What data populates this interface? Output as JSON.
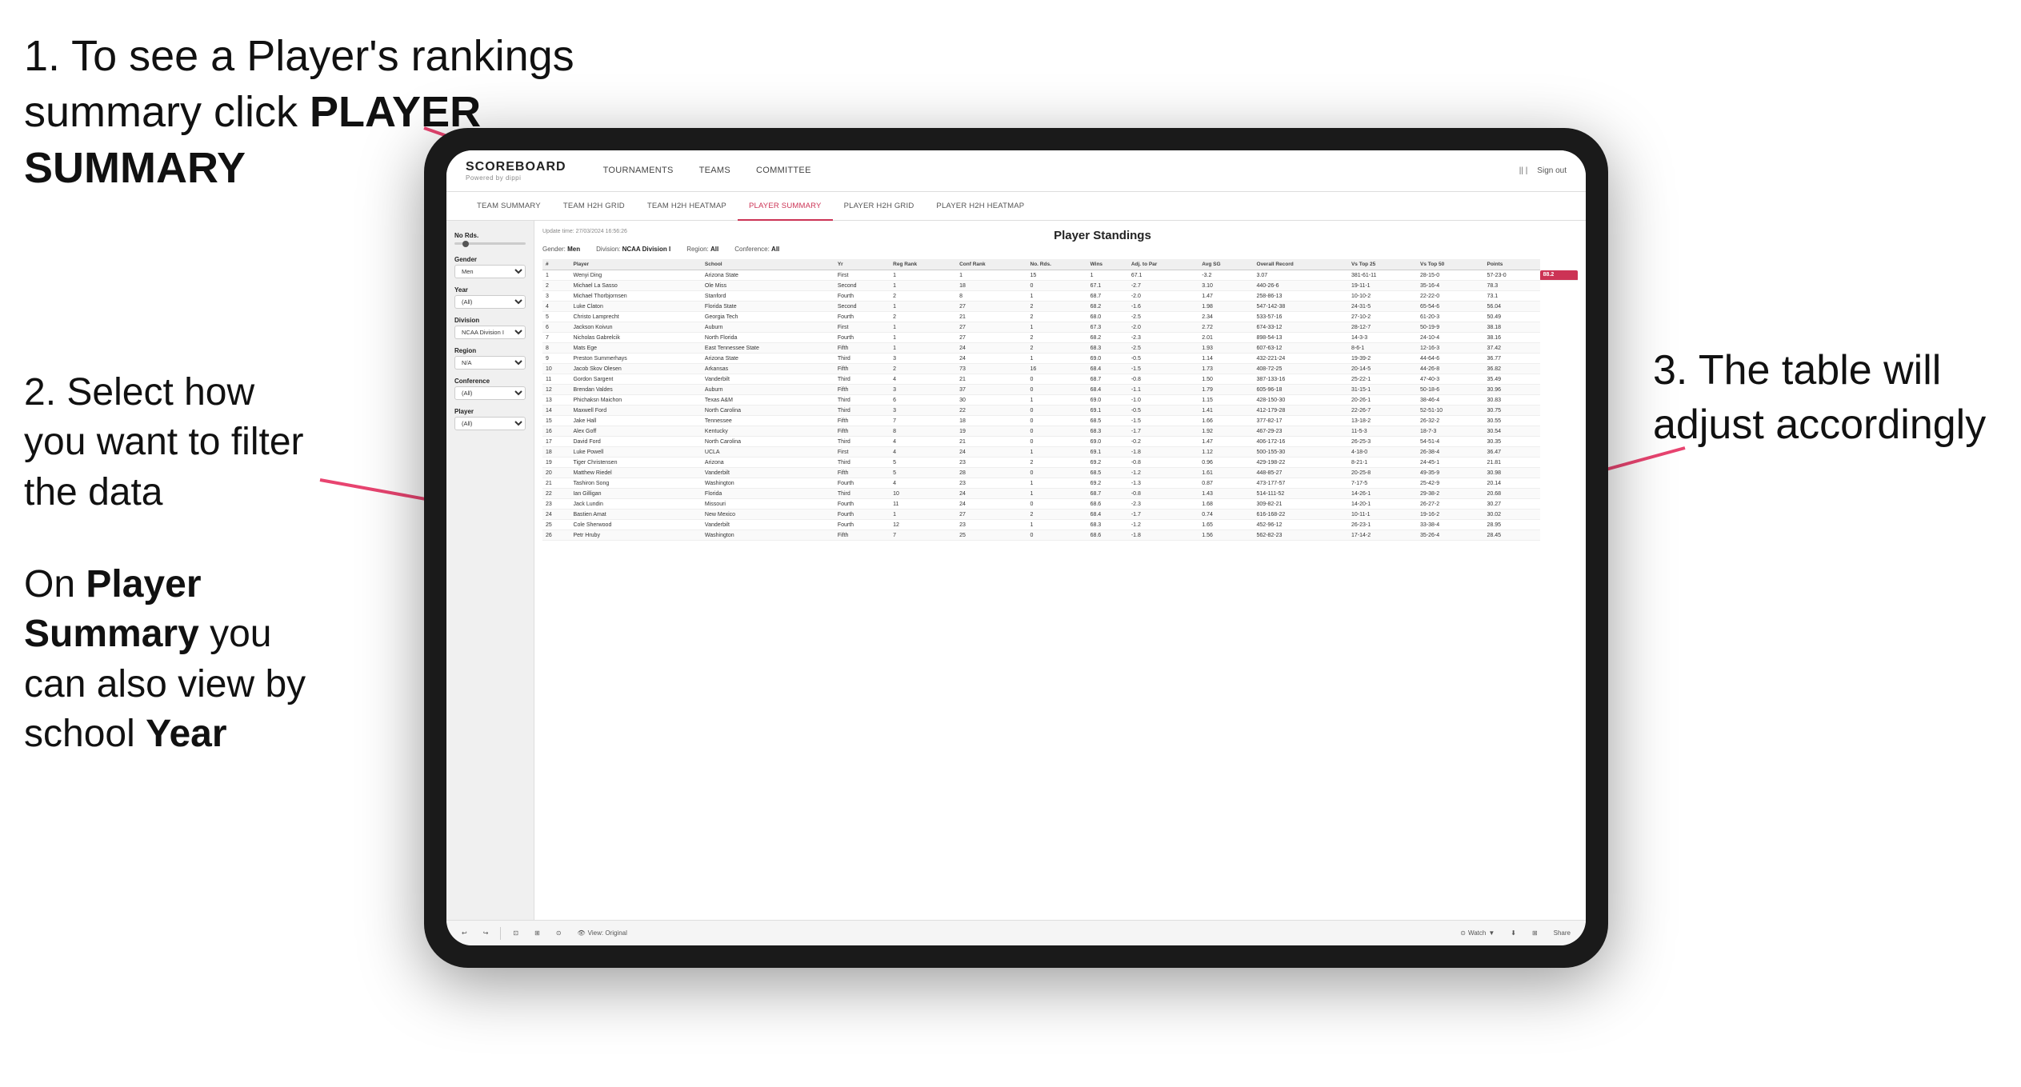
{
  "instructions": {
    "step1": "1. To see a Player's rankings summary click ",
    "step1_bold": "PLAYER SUMMARY",
    "step2_title": "2. Select how you want to filter the data",
    "step3": "3. The table will adjust accordingly",
    "step4_pre": "On ",
    "step4_bold1": "Player Summary",
    "step4_mid": " you can also view by school ",
    "step4_bold2": "Year"
  },
  "app": {
    "logo_main": "SCOREBOARD",
    "logo_sub": "Powered by dippi",
    "nav": [
      {
        "label": "TOURNAMENTS",
        "active": false
      },
      {
        "label": "TEAMS",
        "active": false
      },
      {
        "label": "COMMITTEE",
        "active": false
      }
    ],
    "header_right_icon": "||",
    "sign_out": "Sign out",
    "sub_nav": [
      {
        "label": "TEAM SUMMARY",
        "active": false
      },
      {
        "label": "TEAM H2H GRID",
        "active": false
      },
      {
        "label": "TEAM H2H HEATMAP",
        "active": false
      },
      {
        "label": "PLAYER SUMMARY",
        "active": true
      },
      {
        "label": "PLAYER H2H GRID",
        "active": false
      },
      {
        "label": "PLAYER H2H HEATMAP",
        "active": false
      }
    ]
  },
  "filters": {
    "no_rds_label": "No Rds.",
    "gender_label": "Gender",
    "gender_value": "Men",
    "year_label": "Year",
    "year_value": "(All)",
    "division_label": "Division",
    "division_value": "NCAA Division I",
    "region_label": "Region",
    "region_value": "N/A",
    "conference_label": "Conference",
    "conference_value": "(All)",
    "player_label": "Player",
    "player_value": "(All)"
  },
  "table": {
    "title": "Player Standings",
    "update_time": "Update time:",
    "update_date": "27/03/2024 16:56:26",
    "meta": [
      {
        "label": "Gender: ",
        "value": "Men"
      },
      {
        "label": "Division: ",
        "value": "NCAA Division I"
      },
      {
        "label": "Region: ",
        "value": "All"
      },
      {
        "label": "Conference: ",
        "value": "All"
      }
    ],
    "columns": [
      "#",
      "Player",
      "School",
      "Yr",
      "Reg Rank",
      "Conf Rank",
      "No. Rds.",
      "Wins",
      "Adj. to Par",
      "Avg SG",
      "Overall Record",
      "Vs Top 25",
      "Vs Top 50",
      "Points"
    ],
    "rows": [
      [
        "1",
        "Wenyi Ding",
        "Arizona State",
        "First",
        "1",
        "1",
        "15",
        "1",
        "67.1",
        "-3.2",
        "3.07",
        "381-61-11",
        "28-15-0",
        "57-23-0",
        "88.2"
      ],
      [
        "2",
        "Michael La Sasso",
        "Ole Miss",
        "Second",
        "1",
        "18",
        "0",
        "67.1",
        "-2.7",
        "3.10",
        "440-26-6",
        "19-11-1",
        "35-16-4",
        "78.3"
      ],
      [
        "3",
        "Michael Thorbjornsen",
        "Stanford",
        "Fourth",
        "2",
        "8",
        "1",
        "68.7",
        "-2.0",
        "1.47",
        "258-86-13",
        "10-10-2",
        "22-22-0",
        "73.1"
      ],
      [
        "4",
        "Luke Claton",
        "Florida State",
        "Second",
        "1",
        "27",
        "2",
        "68.2",
        "-1.6",
        "1.98",
        "547-142-38",
        "24-31-5",
        "65-54-6",
        "56.04"
      ],
      [
        "5",
        "Christo Lamprecht",
        "Georgia Tech",
        "Fourth",
        "2",
        "21",
        "2",
        "68.0",
        "-2.5",
        "2.34",
        "533-57-16",
        "27-10-2",
        "61-20-3",
        "50.49"
      ],
      [
        "6",
        "Jackson Koivun",
        "Auburn",
        "First",
        "1",
        "27",
        "1",
        "67.3",
        "-2.0",
        "2.72",
        "674-33-12",
        "28-12-7",
        "50-19-9",
        "38.18"
      ],
      [
        "7",
        "Nicholas Gabrelcik",
        "North Florida",
        "Fourth",
        "1",
        "27",
        "2",
        "68.2",
        "-2.3",
        "2.01",
        "898-54-13",
        "14-3-3",
        "24-10-4",
        "38.16"
      ],
      [
        "8",
        "Mats Ege",
        "East Tennessee State",
        "Fifth",
        "1",
        "24",
        "2",
        "68.3",
        "-2.5",
        "1.93",
        "607-63-12",
        "8-6-1",
        "12-16-3",
        "37.42"
      ],
      [
        "9",
        "Preston Summerhays",
        "Arizona State",
        "Third",
        "3",
        "24",
        "1",
        "69.0",
        "-0.5",
        "1.14",
        "432-221-24",
        "19-39-2",
        "44-64-6",
        "36.77"
      ],
      [
        "10",
        "Jacob Skov Olesen",
        "Arkansas",
        "Fifth",
        "2",
        "73",
        "16",
        "68.4",
        "-1.5",
        "1.73",
        "408-72-25",
        "20-14-5",
        "44-26-8",
        "36.82"
      ],
      [
        "11",
        "Gordon Sargent",
        "Vanderbilt",
        "Third",
        "4",
        "21",
        "0",
        "68.7",
        "-0.8",
        "1.50",
        "387-133-16",
        "25-22-1",
        "47-40-3",
        "35.49"
      ],
      [
        "12",
        "Brendan Valdes",
        "Auburn",
        "Fifth",
        "3",
        "37",
        "0",
        "68.4",
        "-1.1",
        "1.79",
        "605-96-18",
        "31-15-1",
        "50-18-6",
        "30.96"
      ],
      [
        "13",
        "Phichaksn Maichon",
        "Texas A&M",
        "Third",
        "6",
        "30",
        "1",
        "69.0",
        "-1.0",
        "1.15",
        "428-150-30",
        "20-26-1",
        "38-46-4",
        "30.83"
      ],
      [
        "14",
        "Maxwell Ford",
        "North Carolina",
        "Third",
        "3",
        "22",
        "0",
        "69.1",
        "-0.5",
        "1.41",
        "412-179-28",
        "22-26-7",
        "52-51-10",
        "30.75"
      ],
      [
        "15",
        "Jake Hall",
        "Tennessee",
        "Fifth",
        "7",
        "18",
        "0",
        "68.5",
        "-1.5",
        "1.66",
        "377-82-17",
        "13-18-2",
        "26-32-2",
        "30.55"
      ],
      [
        "16",
        "Alex Goff",
        "Kentucky",
        "Fifth",
        "8",
        "19",
        "0",
        "68.3",
        "-1.7",
        "1.92",
        "467-29-23",
        "11-5-3",
        "18-7-3",
        "30.54"
      ],
      [
        "17",
        "David Ford",
        "North Carolina",
        "Third",
        "4",
        "21",
        "0",
        "69.0",
        "-0.2",
        "1.47",
        "406-172-16",
        "26-25-3",
        "54-51-4",
        "30.35"
      ],
      [
        "18",
        "Luke Powell",
        "UCLA",
        "First",
        "4",
        "24",
        "1",
        "69.1",
        "-1.8",
        "1.12",
        "500-155-30",
        "4-18-0",
        "26-38-4",
        "36.47"
      ],
      [
        "19",
        "Tiger Christensen",
        "Arizona",
        "Third",
        "5",
        "23",
        "2",
        "69.2",
        "-0.8",
        "0.96",
        "429-198-22",
        "8-21-1",
        "24-45-1",
        "21.81"
      ],
      [
        "20",
        "Matthew Riedel",
        "Vanderbilt",
        "Fifth",
        "5",
        "28",
        "0",
        "68.5",
        "-1.2",
        "1.61",
        "448-85-27",
        "20-25-8",
        "49-35-9",
        "30.98"
      ],
      [
        "21",
        "Tashiron Song",
        "Washington",
        "Fourth",
        "4",
        "23",
        "1",
        "69.2",
        "-1.3",
        "0.87",
        "473-177-57",
        "7-17-5",
        "25-42-9",
        "20.14"
      ],
      [
        "22",
        "Ian Gilligan",
        "Florida",
        "Third",
        "10",
        "24",
        "1",
        "68.7",
        "-0.8",
        "1.43",
        "514-111-52",
        "14-26-1",
        "29-38-2",
        "20.68"
      ],
      [
        "23",
        "Jack Lundin",
        "Missouri",
        "Fourth",
        "11",
        "24",
        "0",
        "68.6",
        "-2.3",
        "1.68",
        "309-82-21",
        "14-20-1",
        "26-27-2",
        "30.27"
      ],
      [
        "24",
        "Bastien Amat",
        "New Mexico",
        "Fourth",
        "1",
        "27",
        "2",
        "68.4",
        "-1.7",
        "0.74",
        "616-168-22",
        "10-11-1",
        "19-16-2",
        "30.02"
      ],
      [
        "25",
        "Cole Sherwood",
        "Vanderbilt",
        "Fourth",
        "12",
        "23",
        "1",
        "68.3",
        "-1.2",
        "1.65",
        "452-96-12",
        "26-23-1",
        "33-38-4",
        "28.95"
      ],
      [
        "26",
        "Petr Hruby",
        "Washington",
        "Fifth",
        "7",
        "25",
        "0",
        "68.6",
        "-1.8",
        "1.56",
        "562-82-23",
        "17-14-2",
        "35-26-4",
        "28.45"
      ]
    ]
  },
  "toolbar": {
    "view_label": "View: Original",
    "watch_label": "Watch",
    "share_label": "Share"
  }
}
